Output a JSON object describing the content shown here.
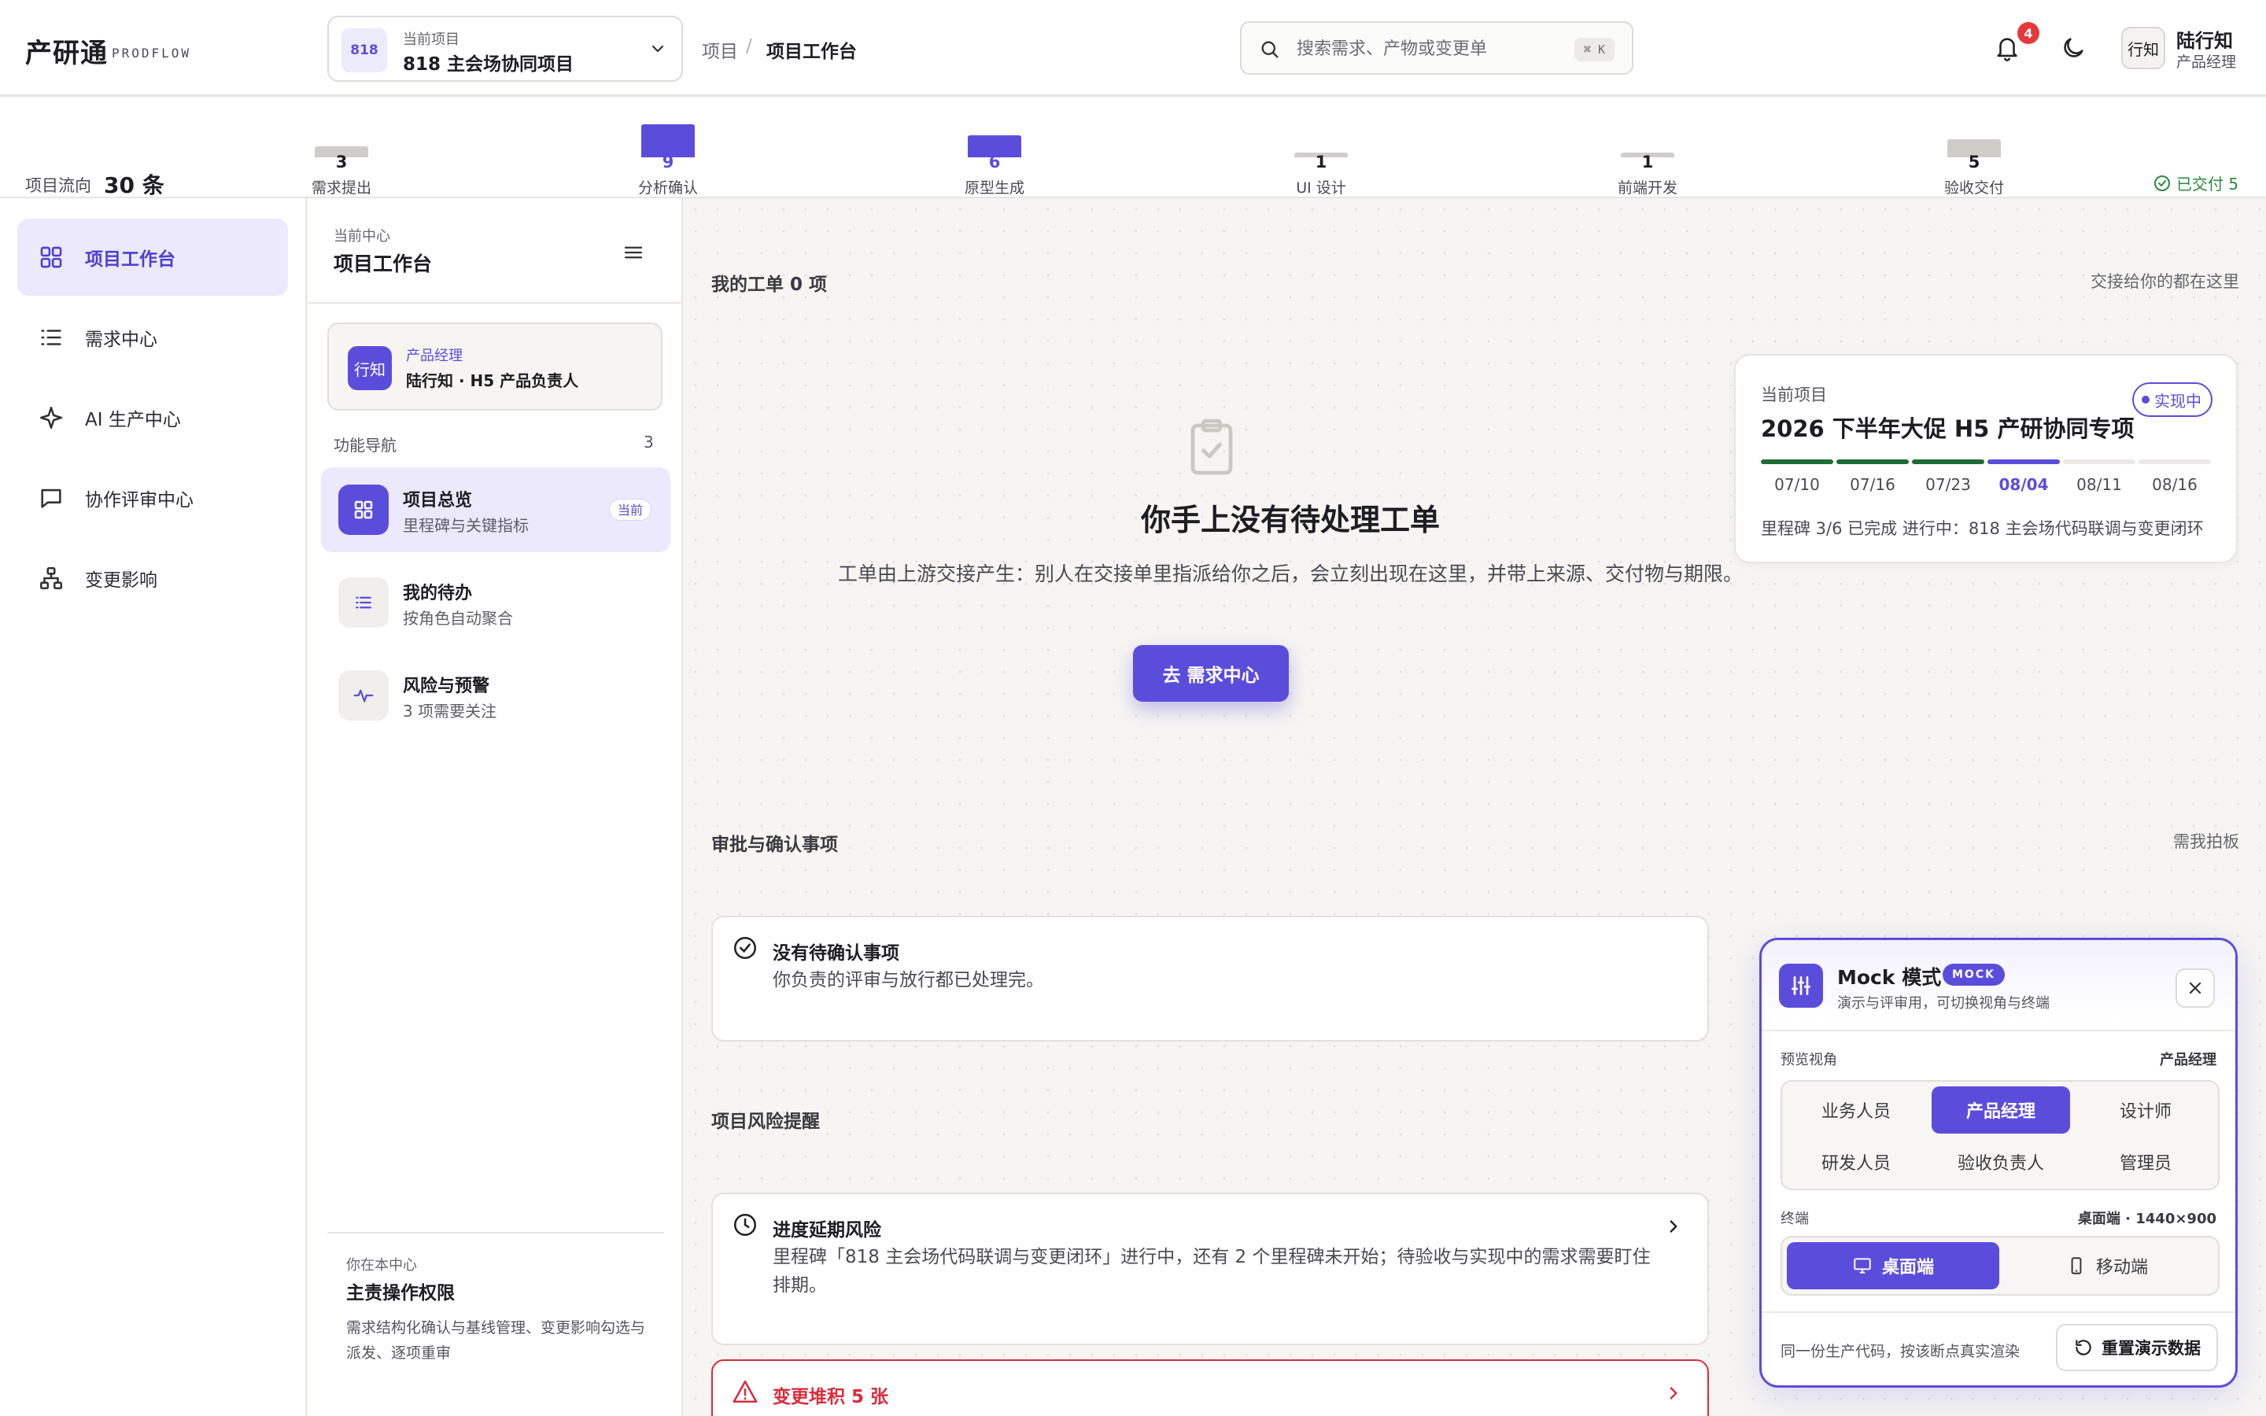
{
  "brand": {
    "name": "产研通",
    "sub": "PRODFLOW"
  },
  "project": {
    "badge": "818",
    "caption": "当前项目",
    "name": "818 主会场协同项目"
  },
  "breadcrumb": {
    "root": "项目",
    "sep": "/",
    "current": "项目工作台"
  },
  "search": {
    "placeholder": "搜索需求、产物或变更单",
    "shortcut": "⌘ K"
  },
  "notifications": {
    "count": "4"
  },
  "user": {
    "avatar": "行知",
    "name": "陆行知",
    "role": "产品经理"
  },
  "flow": {
    "label": "项目流向",
    "total": "30 条",
    "stages": [
      {
        "name": "需求提出",
        "count": "3",
        "highlight": false
      },
      {
        "name": "分析确认",
        "count": "9",
        "highlight": true
      },
      {
        "name": "原型生成",
        "count": "6",
        "highlight": true
      },
      {
        "name": "UI 设计",
        "count": "1",
        "highlight": false
      },
      {
        "name": "前端开发",
        "count": "1",
        "highlight": false
      },
      {
        "name": "验收交付",
        "count": "5",
        "highlight": false
      }
    ],
    "delivered": "已交付 5"
  },
  "nav": {
    "items": [
      {
        "label": "项目工作台",
        "icon": "grid-icon",
        "active": true
      },
      {
        "label": "需求中心",
        "icon": "list-icon",
        "active": false
      },
      {
        "label": "AI 生产中心",
        "icon": "sparkle-icon",
        "active": false
      },
      {
        "label": "协作评审中心",
        "icon": "chat-icon",
        "active": false
      },
      {
        "label": "变更影响",
        "icon": "hierarchy-icon",
        "active": false
      }
    ]
  },
  "sub": {
    "caption": "当前中心",
    "title": "项目工作台",
    "role_card": {
      "badge": "行知",
      "caption": "产品经理",
      "desc": "陆行知 · H5 产品负责人"
    },
    "fn_label": "功能导航",
    "fn_count": "3",
    "items": [
      {
        "title": "项目总览",
        "sub": "里程碑与关键指标",
        "tag": "当前"
      },
      {
        "title": "我的待办",
        "sub": "按角色自动聚合"
      },
      {
        "title": "风险与预警",
        "sub": "3 项需要关注"
      }
    ],
    "perm": {
      "caption": "你在本中心",
      "title": "主责操作权限",
      "desc": "需求结构化确认与基线管理、变更影响勾选与派发、逐项重审"
    }
  },
  "main": {
    "my_tickets": {
      "title": "我的工单 0 项",
      "right": "交接给你的都在这里"
    },
    "empty": {
      "title": "你手上没有待处理工单",
      "desc": "工单由上游交接产生：别人在交接单里指派给你之后，会立刻出现在这里，并带上来源、交付物与期限。",
      "cta": "去 需求中心"
    },
    "project_card": {
      "caption": "当前项目",
      "title": "2026 下半年大促 H5 产研协同专项",
      "status": "实现中",
      "milestones": [
        {
          "date": "07/10",
          "state": "done"
        },
        {
          "date": "07/16",
          "state": "done"
        },
        {
          "date": "07/23",
          "state": "done"
        },
        {
          "date": "08/04",
          "state": "current"
        },
        {
          "date": "08/11",
          "state": "todo"
        },
        {
          "date": "08/16",
          "state": "todo"
        }
      ],
      "footer": "里程碑 3/6 已完成   进行中：818 主会场代码联调与变更闭环"
    },
    "approvals": {
      "title": "审批与确认事项",
      "right": "需我拍板",
      "card_title": "没有待确认事项",
      "card_desc": "你负责的评审与放行都已处理完。"
    },
    "risks": {
      "title": "项目风险提醒",
      "items": [
        {
          "title": "进度延期风险",
          "desc": "里程碑「818 主会场代码联调与变更闭环」进行中，还有 2 个里程碑未开始；待验收与实现中的需求需要盯住排期。"
        },
        {
          "title": "变更堆积 5 张"
        }
      ]
    }
  },
  "mock": {
    "title": "Mock 模式",
    "tag": "MOCK",
    "sub": "演示与评审用，可切换视角与终端",
    "view_label": "预览视角",
    "view_value": "产品经理",
    "roles": [
      "业务人员",
      "产品经理",
      "设计师",
      "研发人员",
      "验收负责人",
      "管理员"
    ],
    "active_role": "产品经理",
    "term_label": "终端",
    "term_value": "桌面端 · 1440×900",
    "terminals": [
      {
        "label": "桌面端",
        "active": true
      },
      {
        "label": "移动端",
        "active": false
      }
    ],
    "footer": "同一份生产代码，按该断点真实渲染",
    "reset": "重置演示数据"
  },
  "colors": {
    "accent": "#5b4ddb",
    "success": "#2a8a3e",
    "danger": "#d92d3c",
    "muted_bar": "#cfcdc7"
  }
}
